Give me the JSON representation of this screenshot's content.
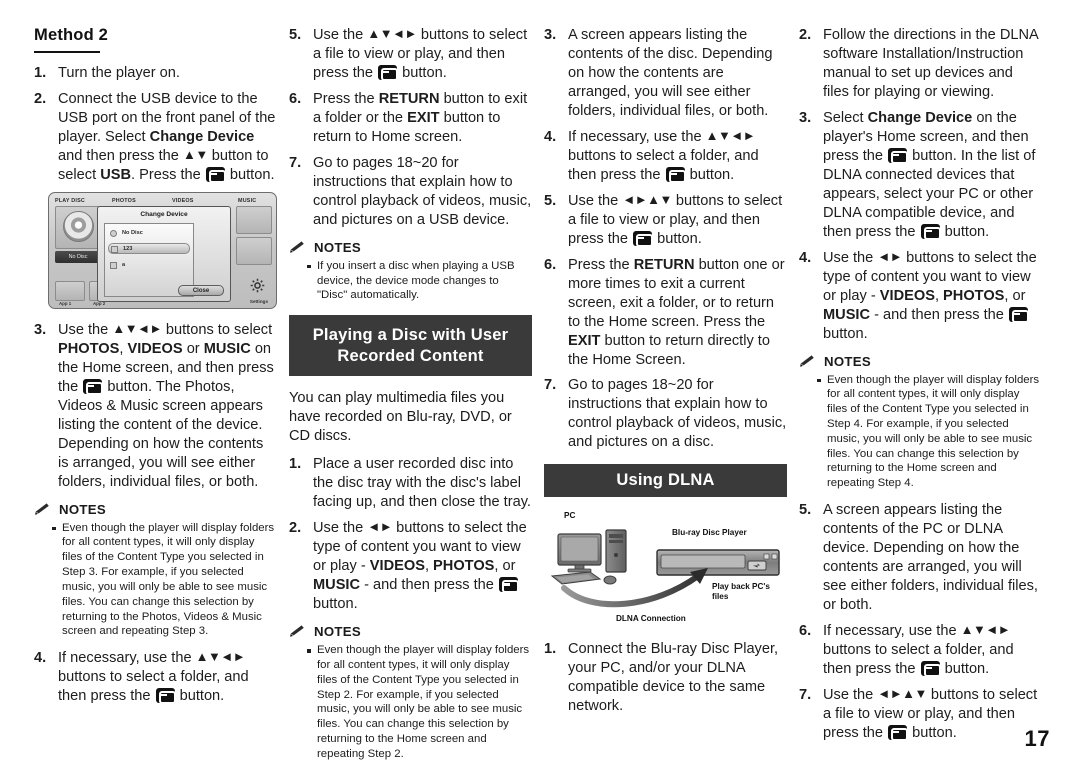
{
  "page": {
    "number": "17"
  },
  "icons": {
    "enter_button": "enter-button-icon",
    "pencil": "pencil-icon"
  },
  "notes_label": "NOTES",
  "column1": {
    "method_title": "Method 2",
    "steps": [
      {
        "num": "1.",
        "parts": [
          {
            "t": "Turn the player on."
          }
        ]
      },
      {
        "num": "2.",
        "parts": [
          {
            "t": "Connect the USB device to the USB port on the front panel of the player. Select "
          },
          {
            "t": "Change Device",
            "b": true
          },
          {
            "t": " and then press the "
          },
          {
            "t": "▲▼",
            "a": true
          },
          {
            "t": " button to select "
          },
          {
            "t": "USB",
            "b": true
          },
          {
            "t": ". Press the "
          },
          {
            "t": "",
            "ent": true
          },
          {
            "t": " button."
          }
        ]
      }
    ],
    "figure": {
      "labels": {
        "play_disc": "PLAY DISC",
        "photos": "PHOTOS",
        "videos": "VIDEOS",
        "music": "MUSIC"
      },
      "dialog_title": "Change Device",
      "rows": [
        "No Disc",
        "123",
        "a"
      ],
      "close_button": "Close",
      "no_disc_tile": "No Disc",
      "app1": "App 1",
      "app2": "App 2",
      "settings": "Settings"
    },
    "steps2": [
      {
        "num": "3.",
        "parts": [
          {
            "t": "Use the "
          },
          {
            "t": "▲▼◄►",
            "a": true
          },
          {
            "t": " buttons to select "
          },
          {
            "t": "PHOTOS",
            "b": true
          },
          {
            "t": ", "
          },
          {
            "t": "VIDEOS",
            "b": true
          },
          {
            "t": " or "
          },
          {
            "t": "MUSIC",
            "b": true
          },
          {
            "t": " on the Home screen, and then press the "
          },
          {
            "t": "",
            "ent": true
          },
          {
            "t": " button. The Photos, Videos & Music screen appears listing the content of the device. Depending on how the contents is arranged, you will see either folders, individual files, or both."
          }
        ]
      }
    ],
    "notes": [
      "Even though the player will display folders for all content types, it will only display files of the Content Type you selected in Step 3. For example, if you selected music, you will only be able to see music files. You can change this selection by returning to the Photos, Videos & Music screen and repeating Step 3."
    ],
    "steps3": [
      {
        "num": "4.",
        "parts": [
          {
            "t": "If necessary, use the "
          },
          {
            "t": "▲▼◄►",
            "a": true
          },
          {
            "t": " buttons to select a folder, and then press the "
          },
          {
            "t": "",
            "ent": true
          },
          {
            "t": " button."
          }
        ]
      }
    ]
  },
  "column2": {
    "steps": [
      {
        "num": "5.",
        "parts": [
          {
            "t": "Use the "
          },
          {
            "t": "▲▼◄►",
            "a": true
          },
          {
            "t": " buttons to select a file to view or play, and then press the "
          },
          {
            "t": "",
            "ent": true
          },
          {
            "t": " button."
          }
        ]
      },
      {
        "num": "6.",
        "parts": [
          {
            "t": "Press the "
          },
          {
            "t": "RETURN",
            "b": true
          },
          {
            "t": " button to exit a folder or the "
          },
          {
            "t": "EXIT",
            "b": true
          },
          {
            "t": " button to return to Home screen."
          }
        ]
      },
      {
        "num": "7.",
        "parts": [
          {
            "t": "Go to pages 18~20 for instructions that explain how to control playback of videos, music, and pictures on a USB device."
          }
        ]
      }
    ],
    "notes": [
      "If you insert a disc when playing a USB device, the device mode changes to \"Disc\" automatically."
    ],
    "banner": "Playing a Disc with User Recorded Content",
    "intro": "You can play multimedia files you have recorded on Blu-ray, DVD, or CD discs.",
    "steps2": [
      {
        "num": "1.",
        "parts": [
          {
            "t": "Place a user recorded disc into the disc tray with the disc's label facing up, and then close the tray."
          }
        ]
      },
      {
        "num": "2.",
        "parts": [
          {
            "t": "Use the "
          },
          {
            "t": "◄►",
            "a": true
          },
          {
            "t": " buttons to select the type of content you want to view or play - "
          },
          {
            "t": "VIDEOS",
            "b": true
          },
          {
            "t": ", "
          },
          {
            "t": "PHOTOS",
            "b": true
          },
          {
            "t": ", or "
          },
          {
            "t": "MUSIC",
            "b": true
          },
          {
            "t": " - and then press the "
          },
          {
            "t": "",
            "ent": true
          },
          {
            "t": " button."
          }
        ]
      }
    ],
    "notes2": [
      "Even though the player will display folders for all content types, it will only display files of the Content Type you selected in Step 2. For example, if you selected music, you will only be able to see music files. You can change this selection by returning to the Home screen and repeating Step 2."
    ]
  },
  "column3": {
    "steps": [
      {
        "num": "3.",
        "parts": [
          {
            "t": "A screen appears listing the contents of the disc. Depending on how the contents are arranged, you will see either folders, individual files, or both."
          }
        ]
      },
      {
        "num": "4.",
        "parts": [
          {
            "t": "If necessary, use the "
          },
          {
            "t": "▲▼◄►",
            "a": true
          },
          {
            "t": " buttons to select a folder, and then press the "
          },
          {
            "t": "",
            "ent": true
          },
          {
            "t": " button."
          }
        ]
      },
      {
        "num": "5.",
        "parts": [
          {
            "t": "Use the "
          },
          {
            "t": "◄►▲▼",
            "a": true
          },
          {
            "t": " buttons to select a file to view or play, and then press the "
          },
          {
            "t": "",
            "ent": true
          },
          {
            "t": " button."
          }
        ]
      },
      {
        "num": "6.",
        "parts": [
          {
            "t": "Press the "
          },
          {
            "t": "RETURN",
            "b": true
          },
          {
            "t": " button one or more times to exit a current screen, exit a folder, or to return to the Home screen. Press the "
          },
          {
            "t": "EXIT",
            "b": true
          },
          {
            "t": " button to return directly to the Home Screen."
          }
        ]
      },
      {
        "num": "7.",
        "parts": [
          {
            "t": "Go to pages 18~20 for instructions that explain how to control playback of videos, music, and pictures on a disc."
          }
        ]
      }
    ],
    "banner": "Using DLNA",
    "figure": {
      "pc_label": "PC",
      "player_label": "Blu-ray Disc Player",
      "playback_label": "Play back PC's files",
      "connection_label": "DLNA Connection"
    },
    "steps2": [
      {
        "num": "1.",
        "parts": [
          {
            "t": "Connect the Blu-ray Disc Player, your PC, and/or your DLNA compatible device to the same network."
          }
        ]
      }
    ]
  },
  "column4": {
    "steps": [
      {
        "num": "2.",
        "parts": [
          {
            "t": "Follow the directions in the DLNA software Installation/Instruction manual to set up devices and files for playing or viewing."
          }
        ]
      },
      {
        "num": "3.",
        "parts": [
          {
            "t": "Select "
          },
          {
            "t": "Change Device",
            "b": true
          },
          {
            "t": " on the player's Home screen, and then press the "
          },
          {
            "t": "",
            "ent": true
          },
          {
            "t": " button. In the list of DLNA connected devices that appears, select your PC or other DLNA compatible device, and then press the "
          },
          {
            "t": "",
            "ent": true
          },
          {
            "t": " button."
          }
        ]
      },
      {
        "num": "4.",
        "parts": [
          {
            "t": "Use the "
          },
          {
            "t": "◄►",
            "a": true
          },
          {
            "t": " buttons to select the type of content you want to view or play - "
          },
          {
            "t": "VIDEOS",
            "b": true
          },
          {
            "t": ", "
          },
          {
            "t": "PHOTOS",
            "b": true
          },
          {
            "t": ", or "
          },
          {
            "t": "MUSIC",
            "b": true
          },
          {
            "t": " - and then press the "
          },
          {
            "t": "",
            "ent": true
          },
          {
            "t": " button."
          }
        ]
      }
    ],
    "notes": [
      "Even though the player will display folders for all content types, it will only display files of the Content Type you selected in Step 4. For example, if you selected music, you will only be able to see music files. You can change this selection by returning to the Home screen and repeating Step 4."
    ],
    "steps2": [
      {
        "num": "5.",
        "parts": [
          {
            "t": "A screen appears listing the contents of the PC or DLNA device. Depending on how the contents are arranged, you will see either folders, individual files, or both."
          }
        ]
      },
      {
        "num": "6.",
        "parts": [
          {
            "t": "If necessary, use the "
          },
          {
            "t": "▲▼◄►",
            "a": true
          },
          {
            "t": " buttons to select a folder, and then press the "
          },
          {
            "t": "",
            "ent": true
          },
          {
            "t": " button."
          }
        ]
      },
      {
        "num": "7.",
        "parts": [
          {
            "t": "Use the "
          },
          {
            "t": "◄►▲▼",
            "a": true
          },
          {
            "t": " buttons to select a file to view or play, and then press the "
          },
          {
            "t": "",
            "ent": true
          },
          {
            "t": " button."
          }
        ]
      }
    ]
  }
}
